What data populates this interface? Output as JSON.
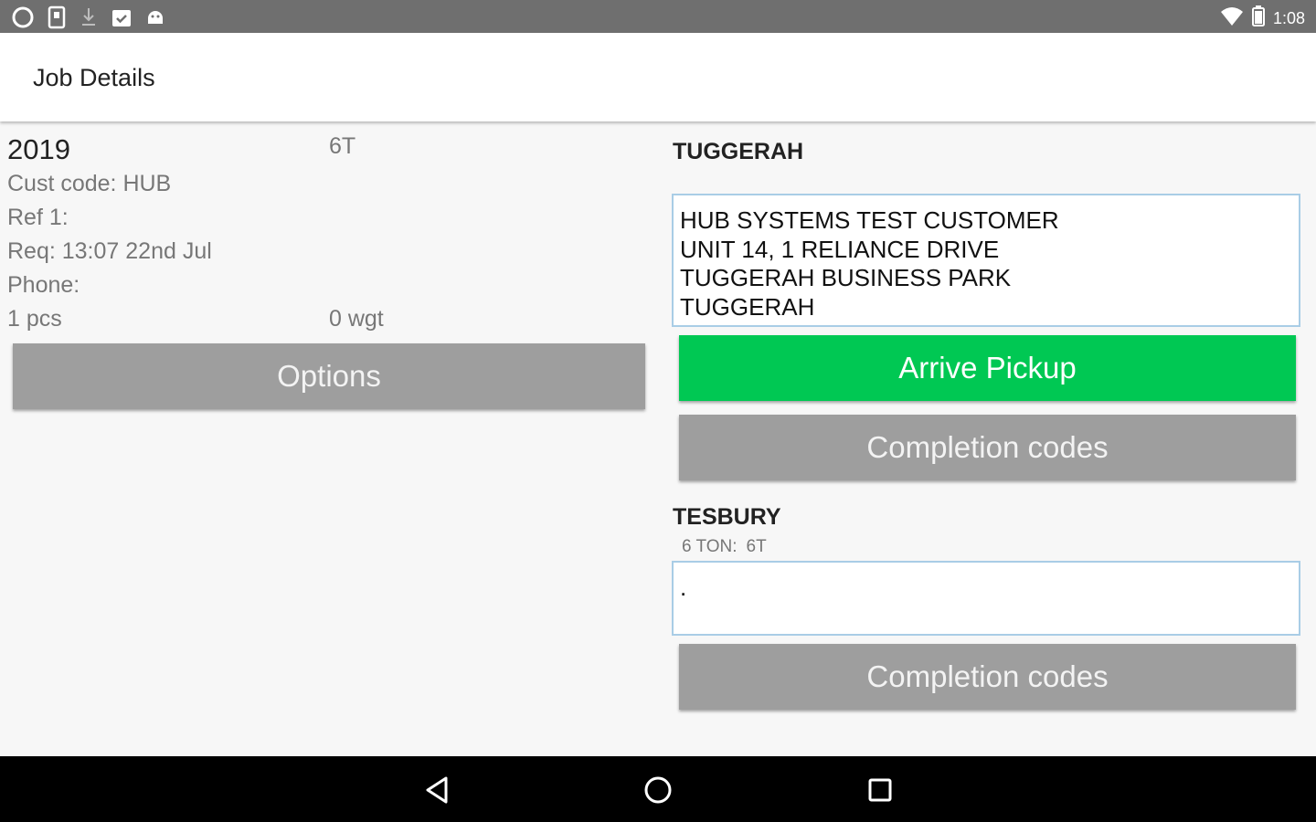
{
  "status_bar": {
    "time": "1:08",
    "left_icons": [
      "circle-notification-icon",
      "phone-notification-icon",
      "download-icon",
      "clipboard-check-icon",
      "android-icon"
    ],
    "right_icons": [
      "wifi-icon",
      "battery-icon"
    ]
  },
  "app_bar": {
    "title": "Job Details"
  },
  "job": {
    "number": "2019",
    "vehicle": "6T",
    "cust_code": "Cust code: HUB",
    "ref": "Ref 1:",
    "req": "Req: 13:07 22nd Jul",
    "phone": "Phone:",
    "pieces": "1 pcs",
    "weight": "0 wgt",
    "options_label": "Options"
  },
  "pickup": {
    "title": "TUGGERAH",
    "address_lines": [
      "HUB SYSTEMS TEST CUSTOMER",
      "UNIT 14, 1 RELIANCE DRIVE",
      "TUGGERAH BUSINESS PARK",
      "TUGGERAH"
    ],
    "arrive_label": "Arrive Pickup",
    "completion_label": "Completion codes"
  },
  "delivery": {
    "title": "TESBURY",
    "vehicle_type": "6 TON:",
    "vehicle_code": "6T",
    "box_text": ".",
    "completion_label": "Completion codes"
  },
  "colors": {
    "arrive_green": "#00c853",
    "button_grey": "#9e9e9e",
    "status_bar": "#6f6f6f",
    "box_border": "#a9cde6"
  },
  "nav_icons": [
    "back-icon",
    "home-icon",
    "recents-icon"
  ]
}
